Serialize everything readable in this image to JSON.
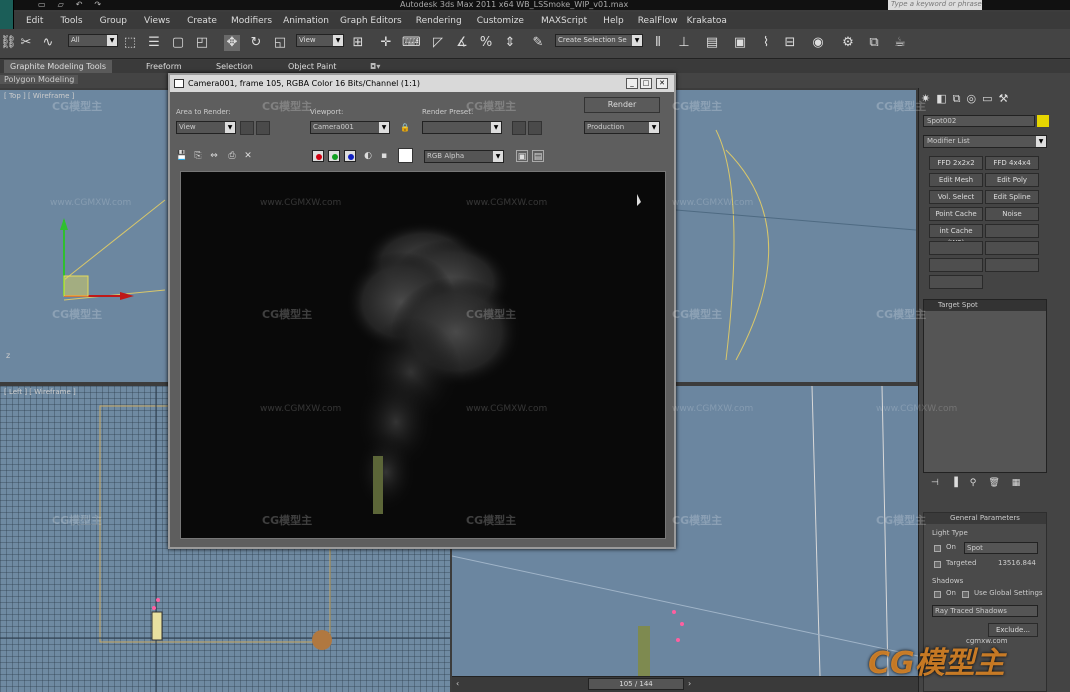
{
  "window": {
    "title": "Autodesk 3ds Max  2011 x64     WB_LSSmoke_WIP_v01.max",
    "search_placeholder": "Type a keyword or phrase"
  },
  "menu": [
    "Edit",
    "Tools",
    "Group",
    "Views",
    "Create",
    "Modifiers",
    "Animation",
    "Graph Editors",
    "Rendering",
    "Customize",
    "MAXScript",
    "Help",
    "RealFlow",
    "Krakatoa"
  ],
  "toolbar": {
    "selection_filter": "All",
    "ref_coord": "View",
    "named_selection": "Create Selection Se"
  },
  "ribbon": {
    "tabs": [
      "Graphite Modeling Tools",
      "Freeform",
      "Selection",
      "Object Paint"
    ],
    "sub_panel": "Polygon Modeling"
  },
  "viewports": {
    "top_left_label": "[ Top ] [ Wireframe ]",
    "bottom_left_label": "[ Left ] [ Wireframe ]"
  },
  "render_window": {
    "title": "Camera001, frame 105, RGBA Color 16 Bits/Channel (1:1)",
    "area_label": "Area to Render:",
    "area_value": "View",
    "viewport_label": "Viewport:",
    "viewport_value": "Camera001",
    "preset_label": "Render Preset:",
    "preset_value": "",
    "render_button": "Render",
    "mode_value": "Production",
    "channel_value": "RGB Alpha"
  },
  "command_panel": {
    "object_name": "Spot002",
    "object_color": "#e6d600",
    "modifier_list": "Modifier List",
    "modifier_buttons": [
      "FFD 2x2x2",
      "FFD 4x4x4",
      "Edit Mesh",
      "Edit Poly",
      "Vol. Select",
      "Edit Spline",
      "Point Cache",
      "Noise",
      "int Cache (WS)",
      ""
    ],
    "stack_item": "Target Spot",
    "rollout_title": "General Parameters",
    "light_type_label": "Light Type",
    "on_label": "On",
    "light_type_value": "Spot",
    "targeted_label": "Targeted",
    "target_distance": "13516.844",
    "shadows_label": "Shadows",
    "shadows_on_label": "On",
    "use_global_label": "Use Global Settings",
    "shadow_type": "Ray Traced Shadows",
    "exclude_button": "Exclude..."
  },
  "timeline": {
    "frame": "105 / 144"
  },
  "watermark": {
    "text": "CG模型主",
    "url": "www.CGMXW.com",
    "small_url": "cgmxw.com"
  }
}
